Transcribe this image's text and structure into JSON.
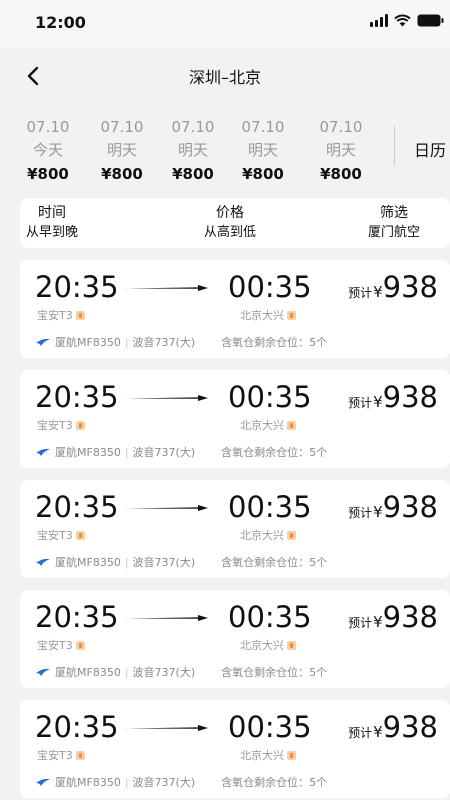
{
  "status_bar": {
    "time": "12:00"
  },
  "header": {
    "title": "深圳–北京"
  },
  "dates": [
    {
      "date": "07.10",
      "weekday": "今天",
      "price": "¥800"
    },
    {
      "date": "07.10",
      "weekday": "明天",
      "price": "¥800"
    },
    {
      "date": "07.10",
      "weekday": "明天",
      "price": "¥800"
    },
    {
      "date": "07.10",
      "weekday": "明天",
      "price": "¥800"
    },
    {
      "date": "07.10",
      "weekday": "明天",
      "price": "¥800"
    }
  ],
  "calendar_label": "日历",
  "sort_options": [
    {
      "title": "时间",
      "subtitle": "从早到晚"
    },
    {
      "title": "价格",
      "subtitle": "从高到低"
    },
    {
      "title": "筛选",
      "subtitle": "厦门航空"
    }
  ],
  "flights": [
    {
      "dep_time": "20:35",
      "arr_time": "00:35",
      "dep_airport": "宝安T3",
      "arr_airport": "北京大兴",
      "price_prefix": "预计",
      "currency": "¥",
      "price": "938",
      "airline": "厦航MF8350",
      "aircraft": "波音737(大)",
      "seats": "含氧仓剩余仓位：5个"
    },
    {
      "dep_time": "20:35",
      "arr_time": "00:35",
      "dep_airport": "宝安T3",
      "arr_airport": "北京大兴",
      "price_prefix": "预计",
      "currency": "¥",
      "price": "938",
      "airline": "厦航MF8350",
      "aircraft": "波音737(大)",
      "seats": "含氧仓剩余仓位：5个"
    },
    {
      "dep_time": "20:35",
      "arr_time": "00:35",
      "dep_airport": "宝安T3",
      "arr_airport": "北京大兴",
      "price_prefix": "预计",
      "currency": "¥",
      "price": "938",
      "airline": "厦航MF8350",
      "aircraft": "波音737(大)",
      "seats": "含氧仓剩余仓位：5个"
    },
    {
      "dep_time": "20:35",
      "arr_time": "00:35",
      "dep_airport": "宝安T3",
      "arr_airport": "北京大兴",
      "price_prefix": "预计",
      "currency": "¥",
      "price": "938",
      "airline": "厦航MF8350",
      "aircraft": "波音737(大)",
      "seats": "含氧仓剩余仓位：5个"
    },
    {
      "dep_time": "20:35",
      "arr_time": "00:35",
      "dep_airport": "宝安T3",
      "arr_airport": "北京大兴",
      "price_prefix": "预计",
      "currency": "¥",
      "price": "938",
      "airline": "厦航MF8350",
      "aircraft": "波音737(大)",
      "seats": "含氧仓剩余仓位：5个"
    }
  ],
  "icons": {
    "back": "chevron-left-icon",
    "signal": "signal-icon",
    "wifi": "wifi-icon",
    "battery": "battery-icon",
    "meal": "meal-icon",
    "airline_logo": "xiamen-airlines-logo-icon",
    "arrow": "flight-arrow-icon"
  },
  "colors": {
    "accent_logo": "#1e6fd6",
    "meal_badge": "#f08c3c"
  }
}
